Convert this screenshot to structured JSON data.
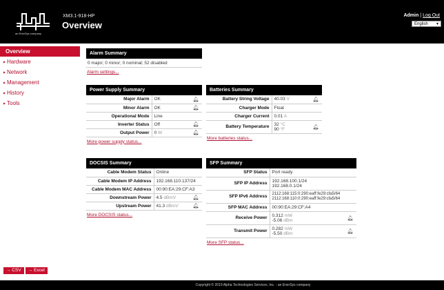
{
  "header": {
    "model": "XM3.1-918-HP",
    "title": "Overview",
    "user": "Admin",
    "logout": "Log Out",
    "language": "English",
    "logo_tagline": "an EnerSys company"
  },
  "nav": [
    {
      "label": "Overview",
      "active": true
    },
    {
      "label": "Hardware",
      "active": false
    },
    {
      "label": "Network",
      "active": false
    },
    {
      "label": "Management",
      "active": false
    },
    {
      "label": "History",
      "active": false
    },
    {
      "label": "Tools",
      "active": false
    }
  ],
  "export": {
    "csv": "→ CSV",
    "excel": "→ Excel"
  },
  "footer": "Copyright © 2019 Alpha Technologies Services, Inc. - an EnerSys company",
  "alarm": {
    "title": "Alarm Summary",
    "summary": "0 major; 0 minor; 0 nominal; 52 disabled",
    "link": "Alarm settings..."
  },
  "power": {
    "title": "Power Supply Summary",
    "rows": [
      {
        "label": "Major Alarm",
        "value": "OK",
        "bell": true
      },
      {
        "label": "Minor Alarm",
        "value": "OK",
        "bell": true
      },
      {
        "label": "Operational Mode",
        "value": "Line",
        "bell": false
      },
      {
        "label": "Inverter Status",
        "value": "Off",
        "bell": true
      },
      {
        "label": "Output Power",
        "value": "0",
        "unit": "W",
        "bell": true
      }
    ],
    "link": "More power supply status..."
  },
  "batteries": {
    "title": "Batteries Summary",
    "voltage_label": "Battery String Voltage",
    "voltage_value": "40.03",
    "voltage_unit": "V",
    "mode_label": "Charger Mode",
    "mode_value": "Float",
    "current_label": "Charger Current",
    "current_value": "0.01",
    "current_unit": "A",
    "temp_label": "Battery Temperature",
    "temp_c": "32",
    "temp_c_unit": "°C",
    "temp_f": "90",
    "temp_f_unit": "°F",
    "link": "More batteries status..."
  },
  "docsis": {
    "title": "DOCSIS Summary",
    "status_label": "Cable Modem Status",
    "status_value": "Online",
    "ip_label": "Cable Modem IP Address",
    "ip_value": "192.168.110.137/24",
    "mac_label": "Cable Modem MAC Address",
    "mac_value": "00:90:EA:29:CF:A3",
    "down_label": "Downstream Power",
    "down_value": "4.5",
    "down_unit": "dBmV",
    "up_label": "Upstream Power",
    "up_value": "41.3",
    "up_unit": "dBmV",
    "link": "More DOCSIS status..."
  },
  "sfp": {
    "title": "SFP Summary",
    "status_label": "SFP Status",
    "status_value": "Port ready",
    "ip_label": "SFP IP Address",
    "ip_1": "192.168.100.1/24",
    "ip_2": "192.168.0.1/24",
    "ipv6_label": "SFP IPv6 Address",
    "ipv6_1": "2112:168:115:0:290:eaff:fe29:cfa5/64",
    "ipv6_2": "2112:168:110:0:290:eaff:fe29:cfa5/64",
    "mac_label": "SFP MAC Address",
    "mac_value": "00:90:EA:29:CF:A4",
    "rx_label": "Receive Power",
    "rx_mw": "0.312",
    "rx_mw_unit": "mW",
    "rx_dbm": "-5.06",
    "rx_dbm_unit": "dBm",
    "tx_label": "Transmit Power",
    "tx_mw": "0.282",
    "tx_mw_unit": "mW",
    "tx_dbm": "-5.50",
    "tx_dbm_unit": "dBm",
    "link": "More SFP status..."
  }
}
